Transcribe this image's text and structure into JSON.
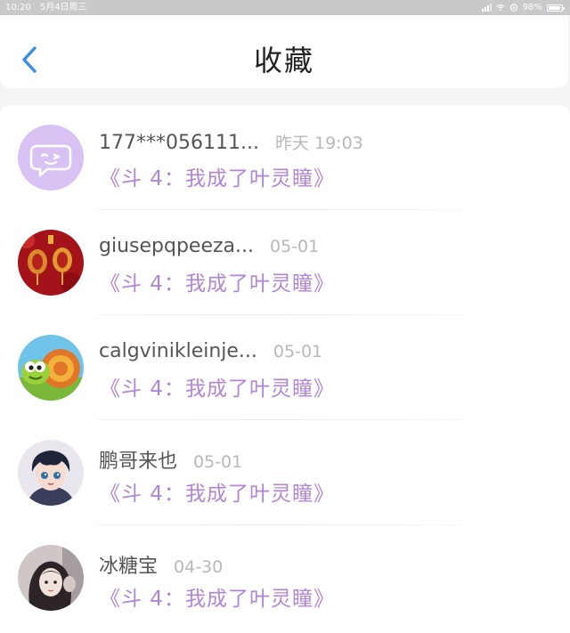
{
  "status_bar": {
    "time": "10:20",
    "date": "5月4日周三",
    "battery": "98%"
  },
  "header": {
    "title": "收藏",
    "back_icon": "chevron-left-icon",
    "accent_color": "#3a8ee6"
  },
  "favorites": [
    {
      "name": "177***056111...",
      "time": "昨天 19:03",
      "title": "《斗 4：我成了叶灵瞳》",
      "avatar": "chat-bubble-avatar"
    },
    {
      "name": "giusepqpeeza...",
      "time": "05-01",
      "title": "《斗 4：我成了叶灵瞳》",
      "avatar": "red-lanterns-avatar"
    },
    {
      "name": "calgvinikleinje...",
      "time": "05-01",
      "title": "《斗 4：我成了叶灵瞳》",
      "avatar": "cartoon-snail-avatar"
    },
    {
      "name": "鹏哥来也",
      "time": "05-01",
      "title": "《斗 4：我成了叶灵瞳》",
      "avatar": "anime-boy-avatar"
    },
    {
      "name": "冰糖宝",
      "time": "04-30",
      "title": "《斗 4：我成了叶灵瞳》",
      "avatar": "girl-photo-avatar"
    }
  ],
  "colors": {
    "link": "#b085d6",
    "name": "#555555",
    "time": "#b8b8b8"
  }
}
